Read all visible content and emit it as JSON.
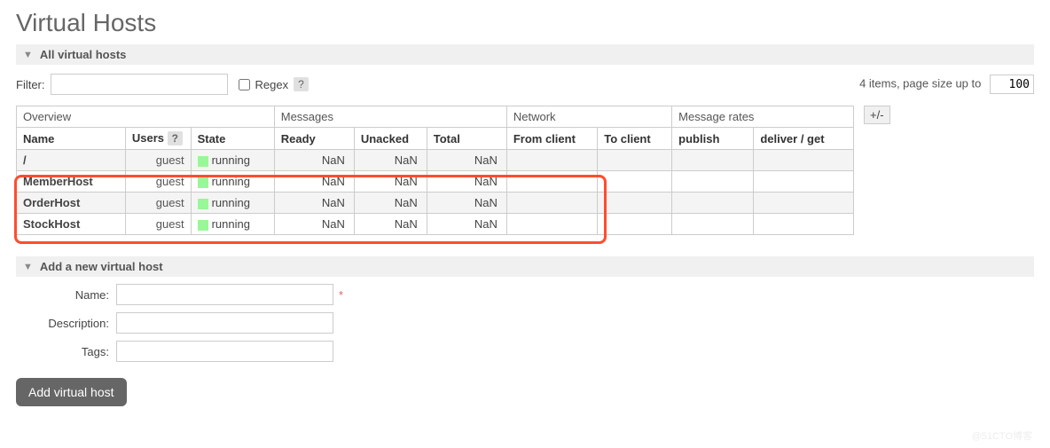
{
  "page": {
    "title": "Virtual Hosts"
  },
  "sections": {
    "all": {
      "title": "All virtual hosts"
    },
    "add": {
      "title": "Add a new virtual host"
    }
  },
  "filter": {
    "label": "Filter:",
    "value": "",
    "regex_label": "Regex",
    "help": "?"
  },
  "pagination": {
    "summary_prefix": "4 items, page size up to",
    "page_size": "100"
  },
  "table": {
    "group_headers": {
      "overview": "Overview",
      "messages": "Messages",
      "network": "Network",
      "message_rates": "Message rates"
    },
    "columns": {
      "name": "Name",
      "users": "Users",
      "users_help": "?",
      "state": "State",
      "ready": "Ready",
      "unacked": "Unacked",
      "total": "Total",
      "from_client": "From client",
      "to_client": "To client",
      "publish": "publish",
      "deliver_get": "deliver / get"
    },
    "plusminus": "+/-",
    "rows": [
      {
        "name": "/",
        "users": "guest",
        "state": "running",
        "ready": "NaN",
        "unacked": "NaN",
        "total": "NaN",
        "from_client": "",
        "to_client": "",
        "publish": "",
        "deliver_get": ""
      },
      {
        "name": "MemberHost",
        "users": "guest",
        "state": "running",
        "ready": "NaN",
        "unacked": "NaN",
        "total": "NaN",
        "from_client": "",
        "to_client": "",
        "publish": "",
        "deliver_get": ""
      },
      {
        "name": "OrderHost",
        "users": "guest",
        "state": "running",
        "ready": "NaN",
        "unacked": "NaN",
        "total": "NaN",
        "from_client": "",
        "to_client": "",
        "publish": "",
        "deliver_get": ""
      },
      {
        "name": "StockHost",
        "users": "guest",
        "state": "running",
        "ready": "NaN",
        "unacked": "NaN",
        "total": "NaN",
        "from_client": "",
        "to_client": "",
        "publish": "",
        "deliver_get": ""
      }
    ]
  },
  "add_form": {
    "name_label": "Name:",
    "description_label": "Description:",
    "tags_label": "Tags:",
    "name_value": "",
    "description_value": "",
    "tags_value": "",
    "button": "Add virtual host",
    "required_mark": "*"
  },
  "watermark": "@51CTO博客"
}
